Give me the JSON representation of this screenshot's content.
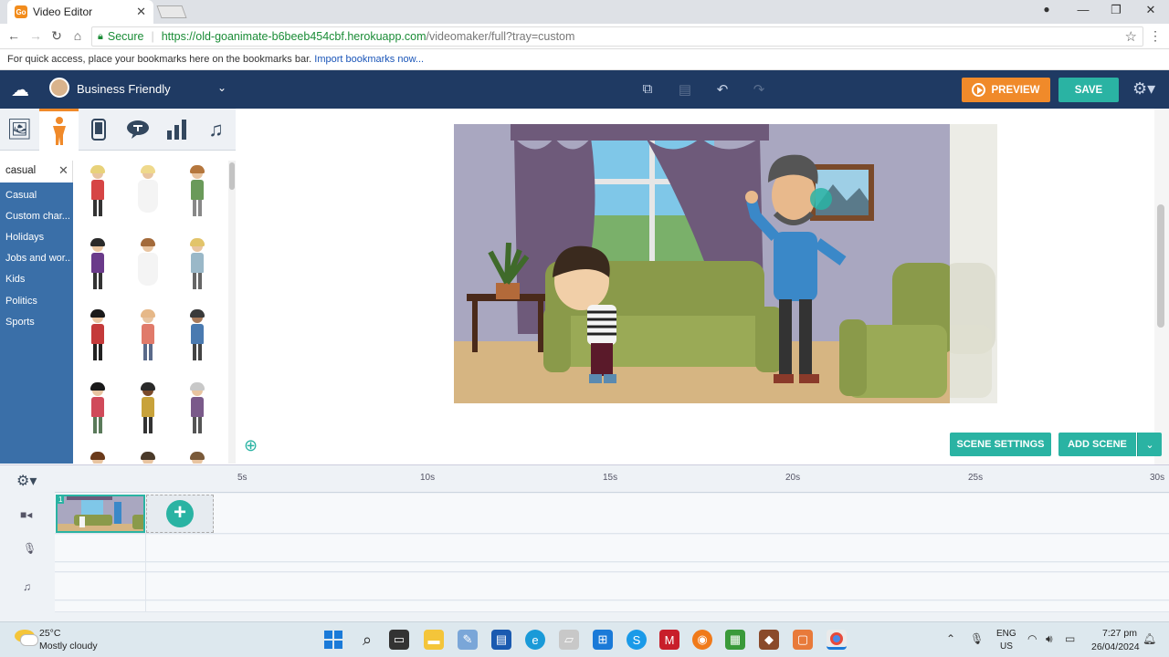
{
  "browser": {
    "tab_title": "Video Editor",
    "tab_favicon_text": "Go",
    "secure_label": "Secure",
    "url_host": "https://old-goanimate-b6beeb454cbf.herokuapp.com",
    "url_path": "/videomaker/full?tray=custom",
    "bookmarks_text": "For quick access, place your bookmarks here on the bookmarks bar.",
    "bookmarks_link": "Import bookmarks now..."
  },
  "toolbar": {
    "theme_name": "Business Friendly",
    "preview_label": "PREVIEW",
    "save_label": "SAVE",
    "accent_color": "#f08a2a",
    "teal_color": "#2ab3a3",
    "bar_color": "#1f3a63"
  },
  "library": {
    "tabs": [
      {
        "name": "backgrounds",
        "icon": "image-icon"
      },
      {
        "name": "characters",
        "icon": "person-icon",
        "active": true
      },
      {
        "name": "props",
        "icon": "phone-icon"
      },
      {
        "name": "text",
        "icon": "speech-bubble-icon"
      },
      {
        "name": "charts",
        "icon": "bar-chart-icon"
      },
      {
        "name": "sound",
        "icon": "music-note-icon"
      }
    ],
    "search_value": "casual",
    "categories": [
      "Casual",
      "Custom char...",
      "Holidays",
      "Jobs and wor...",
      "Kids",
      "Politics",
      "Sports"
    ]
  },
  "stage": {
    "scene_settings_label": "SCENE SETTINGS",
    "add_scene_label": "ADD SCENE"
  },
  "timeline": {
    "ticks": [
      "5s",
      "10s",
      "15s",
      "20s",
      "25s",
      "30s"
    ],
    "scene_number": "1"
  },
  "taskbar": {
    "temperature": "25°C",
    "weather": "Mostly cloudy",
    "lang_1": "ENG",
    "lang_2": "US",
    "time": "7:27 pm",
    "date": "26/04/2024"
  }
}
